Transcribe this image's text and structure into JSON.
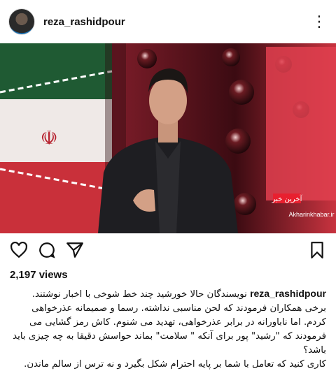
{
  "post": {
    "username": "reza_rashidpour",
    "more_icon": "ellipsis-icon",
    "avatar_icon": "profile-avatar"
  },
  "media": {
    "watermark_text": "Akharinkhabar.ir",
    "channel_logo_text": "آخرین خبر",
    "colors": {
      "background": "#3a0c12",
      "accent": "#e0404f"
    }
  },
  "actions": {
    "like_icon": "heart-icon",
    "comment_icon": "comment-icon",
    "share_icon": "send-icon",
    "save_icon": "bookmark-icon"
  },
  "stats": {
    "views": "2,197 views"
  },
  "caption": {
    "username": "reza_rashidpour",
    "text1": "نویسندگان حالا خورشید چند خط شوخی با اخبار نوشتند. برخی همکاران فرمودند که لحن مناسبی نداشته. رسما و صمیمانه عذرخواهی کردم. اما ناباورانه در برابر عذرخواهی، تهدید می شنوم. کاش رمز گشایی می فرمودند که \"رشید\" پور برای آنکه \" سلامت\" بماند حواسش دقیقا به چه چیزی باید باشد؟",
    "text2": "کاری کنید که تعامل با شما بر پایه احترام شکل بگیرد و نه ترس از سالم ماندن."
  }
}
